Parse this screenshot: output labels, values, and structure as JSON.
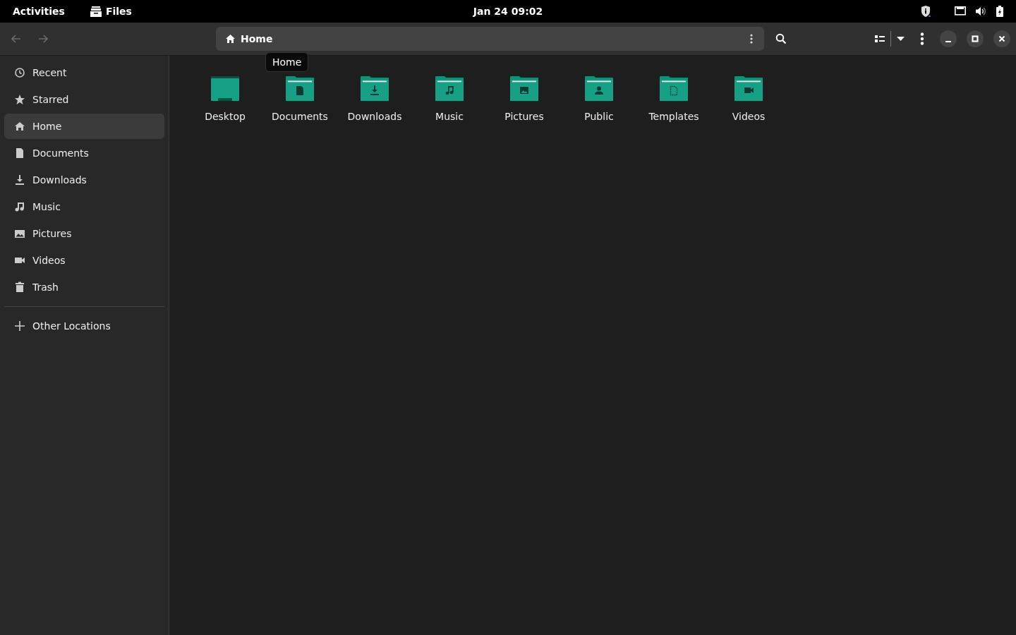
{
  "top_bar": {
    "activities": "Activities",
    "app_name": "Files",
    "clock": "Jan 24  09:02"
  },
  "header": {
    "back_disabled": true,
    "forward_disabled": true,
    "path": "Home",
    "tooltip": "Home"
  },
  "sidebar": {
    "items": [
      {
        "label": "Recent",
        "kind": "recent",
        "selected": false
      },
      {
        "label": "Starred",
        "kind": "starred",
        "selected": false
      },
      {
        "label": "Home",
        "kind": "home",
        "selected": true
      },
      {
        "label": "Documents",
        "kind": "documents",
        "selected": false
      },
      {
        "label": "Downloads",
        "kind": "downloads",
        "selected": false
      },
      {
        "label": "Music",
        "kind": "music",
        "selected": false
      },
      {
        "label": "Pictures",
        "kind": "pictures",
        "selected": false
      },
      {
        "label": "Videos",
        "kind": "videos",
        "selected": false
      },
      {
        "label": "Trash",
        "kind": "trash",
        "selected": false
      }
    ],
    "other_locations": "Other Locations"
  },
  "folders": [
    {
      "name": "Desktop",
      "kind": "desktop"
    },
    {
      "name": "Documents",
      "kind": "documents"
    },
    {
      "name": "Downloads",
      "kind": "downloads"
    },
    {
      "name": "Music",
      "kind": "music"
    },
    {
      "name": "Pictures",
      "kind": "pictures"
    },
    {
      "name": "Public",
      "kind": "public"
    },
    {
      "name": "Templates",
      "kind": "templates"
    },
    {
      "name": "Videos",
      "kind": "videos"
    }
  ]
}
